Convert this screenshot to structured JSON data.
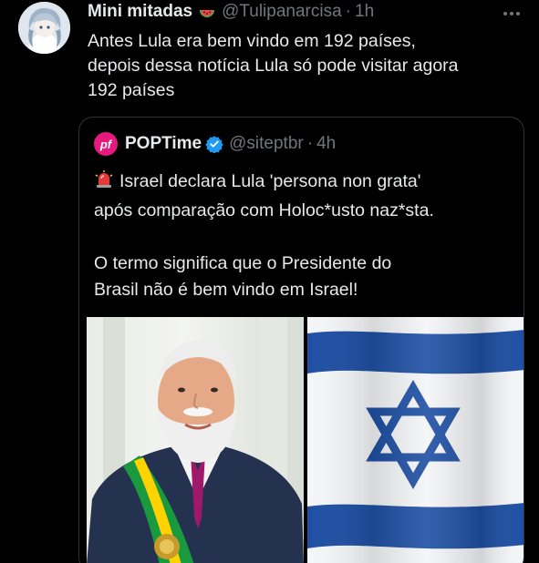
{
  "tweet": {
    "display_name": "Mini mitadas",
    "handle": "@Tulipanarcisa",
    "time": "1h",
    "body_lines": [
      "Antes Lula era bem vindo em 192 países,",
      "depois dessa notícia Lula só pode visitar agora",
      "192 países"
    ],
    "avatar_icon": "anime-avatar-icon",
    "emoji_icon": "watermelon-icon",
    "more_icon": "more-options-icon"
  },
  "quote": {
    "logo_text": "pf",
    "display_name": "POPTime",
    "handle": "@siteptbr",
    "time": "4h",
    "text_line1": "Israel declara Lula 'persona non grata'",
    "text_line2": "após comparação com Holoc*usto naz*sta.",
    "text_line3": "O termo significa que o Presidente do",
    "text_line4": "Brasil não é bem vindo em Israel!",
    "siren_icon": "siren-icon",
    "verified_icon": "verified-badge-icon",
    "images": [
      "lula-portrait-photo",
      "israel-flag-photo"
    ]
  },
  "colors": {
    "background": "#000000",
    "text": "#e7e9ea",
    "muted": "#71767b",
    "border": "#2f3336",
    "verified": "#1d9bf0",
    "logo": "#e6197e",
    "flag_blue": "#1e4fa3"
  }
}
